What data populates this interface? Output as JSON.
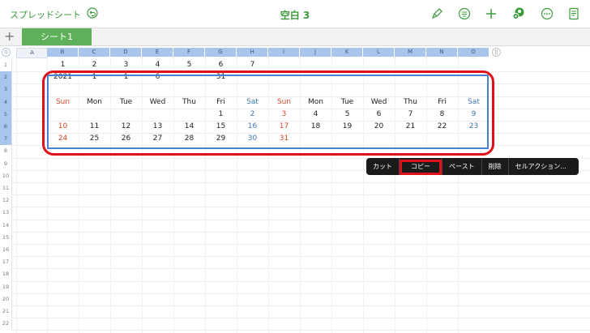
{
  "topbar": {
    "back_label": "スプレッドシート",
    "title": "空白 3",
    "icons": [
      "undo-icon",
      "paintbrush-icon",
      "list-icon",
      "plus-icon",
      "collaborate-icon",
      "more-icon",
      "document-icon"
    ]
  },
  "tabs": {
    "add_label": "+",
    "sheet_label": "シート1"
  },
  "column_headers": [
    "A",
    "B",
    "C",
    "D",
    "E",
    "F",
    "G",
    "H",
    "I",
    "J",
    "K",
    "L",
    "M",
    "N",
    "O"
  ],
  "row_headers": [
    "1",
    "2",
    "3",
    "4",
    "5",
    "6",
    "7",
    "8",
    "9",
    "10",
    "11",
    "12",
    "13",
    "14",
    "15",
    "16",
    "17",
    "18",
    "19",
    "20",
    "21",
    "22"
  ],
  "rows": {
    "r1": [
      "1",
      "2",
      "3",
      "4",
      "5",
      "6",
      "7"
    ],
    "r2": [
      "2021",
      "1",
      "1",
      "6",
      "",
      "31"
    ],
    "r4": [
      "Sun",
      "Mon",
      "Tue",
      "Wed",
      "Thu",
      "Fri",
      "Sat",
      "Sun",
      "Mon",
      "Tue",
      "Wed",
      "Thu",
      "Fri",
      "Sat"
    ],
    "r5": [
      "",
      "",
      "",
      "",
      "",
      "1",
      "2",
      "3",
      "4",
      "5",
      "6",
      "7",
      "8",
      "9"
    ],
    "r6": [
      "10",
      "11",
      "12",
      "13",
      "14",
      "15",
      "16",
      "17",
      "18",
      "19",
      "20",
      "21",
      "22",
      "23"
    ],
    "r7": [
      "24",
      "25",
      "26",
      "27",
      "28",
      "29",
      "30",
      "31",
      "",
      "",
      "",
      "",
      "",
      ""
    ]
  },
  "context_menu": [
    "カット",
    "コピー",
    "ペースト",
    "削除",
    "セルアクション..."
  ],
  "colors": {
    "accent": "#3b9a3b",
    "sunday": "#d9472b",
    "saturday": "#3c78b5",
    "highlight": "#e0101a"
  }
}
